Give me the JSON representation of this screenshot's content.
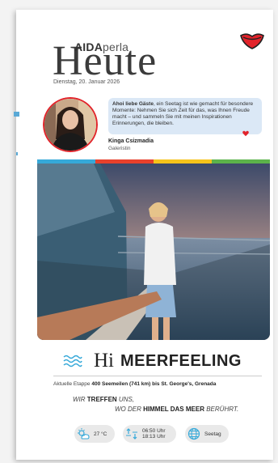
{
  "masthead": {
    "brand_bold": "AIDA",
    "brand_light": "perla",
    "title": "Heute",
    "date": "Dienstag, 20. Januar 2026"
  },
  "greeting": {
    "salutation": "Ahoi liebe Gäste",
    "text": ", ein Seetag ist wie gemacht für besondere Momente: Nehmen Sie sich Zeit für das, was Ihnen Freude macht – und sammeln Sie mit meinen Inspirationen Erinnerungen, die bleiben.",
    "host_name": "Kinga Csizmadia",
    "host_role": "Galeristin"
  },
  "headline": {
    "hi": "Hi",
    "word": "MEERFEELING"
  },
  "etappe": {
    "label": "Aktuelle Etappe",
    "value": "400 Seemeilen (741 km) bis St. George's, Grenada"
  },
  "quote": {
    "l1_a": "WIR",
    "l1_b": "TREFFEN",
    "l1_c": "UNS,",
    "l2_a": "WO DER",
    "l2_b": "HIMMEL DAS MEER",
    "l2_c": "BERÜHRT."
  },
  "info": {
    "temperature": "27 °C",
    "sunrise": "06:50 Uhr",
    "sunset": "18:13 Uhr",
    "day_type": "Seetag"
  },
  "colors": {
    "bar": [
      "#36a9d9",
      "#e8412c",
      "#f6c31b",
      "#5cb34b"
    ],
    "bubble": "#dbe8f6",
    "brand_red": "#e2232a"
  }
}
